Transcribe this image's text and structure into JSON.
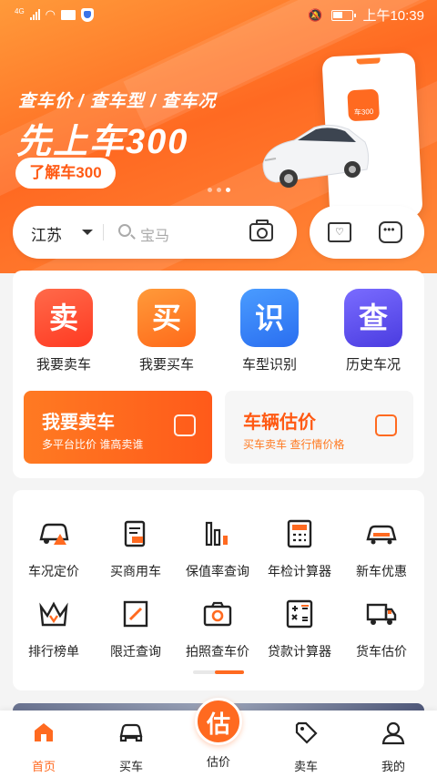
{
  "status_bar": {
    "network": "4G",
    "time": "上午10:39"
  },
  "banner": {
    "subtitle": "查车价 / 查车型 / 查车况",
    "title": "先上车300",
    "button_label": "了解车300",
    "app_badge": "车300",
    "slide_count": 3,
    "active_slide": 3
  },
  "search": {
    "city": "江苏",
    "placeholder": "宝马"
  },
  "quick_actions": [
    {
      "glyph": "卖",
      "label": "我要卖车",
      "color": "#ff4a2e"
    },
    {
      "glyph": "买",
      "label": "我要买车",
      "color": "#ff7a22"
    },
    {
      "glyph": "识",
      "label": "车型识别",
      "color": "#2e7ef6"
    },
    {
      "glyph": "查",
      "label": "历史车况",
      "color": "#5b4ce8"
    }
  ],
  "promos": [
    {
      "title": "我要卖车",
      "subtitle": "多平台比价 谁高卖谁",
      "icon": "car-up-icon"
    },
    {
      "title": "车辆估价",
      "subtitle": "买车卖车 查行情价格",
      "icon": "trend-icon"
    }
  ],
  "tools": [
    {
      "label": "车况定价",
      "icon": "car-warning-icon"
    },
    {
      "label": "买商用车",
      "icon": "truck-doc-icon"
    },
    {
      "label": "保值率查询",
      "icon": "bar-chart-icon"
    },
    {
      "label": "年检计算器",
      "icon": "calculator-icon"
    },
    {
      "label": "新车优惠",
      "icon": "new-car-icon"
    },
    {
      "label": "排行榜单",
      "icon": "crown-icon"
    },
    {
      "label": "限迁查询",
      "icon": "document-icon"
    },
    {
      "label": "拍照查车价",
      "icon": "camera-icon"
    },
    {
      "label": "贷款计算器",
      "icon": "math-calculator-icon"
    },
    {
      "label": "货车估价",
      "icon": "truck-icon"
    }
  ],
  "nav": {
    "items": [
      {
        "label": "首页",
        "icon": "home-icon",
        "active": true
      },
      {
        "label": "买车",
        "icon": "car-icon",
        "active": false
      },
      {
        "label": "估价",
        "icon": "estimate-icon",
        "active": false
      },
      {
        "label": "卖车",
        "icon": "tag-icon",
        "active": false
      },
      {
        "label": "我的",
        "icon": "user-icon",
        "active": false
      }
    ],
    "center_glyph": "估"
  },
  "accent_color": "#ff6a20"
}
